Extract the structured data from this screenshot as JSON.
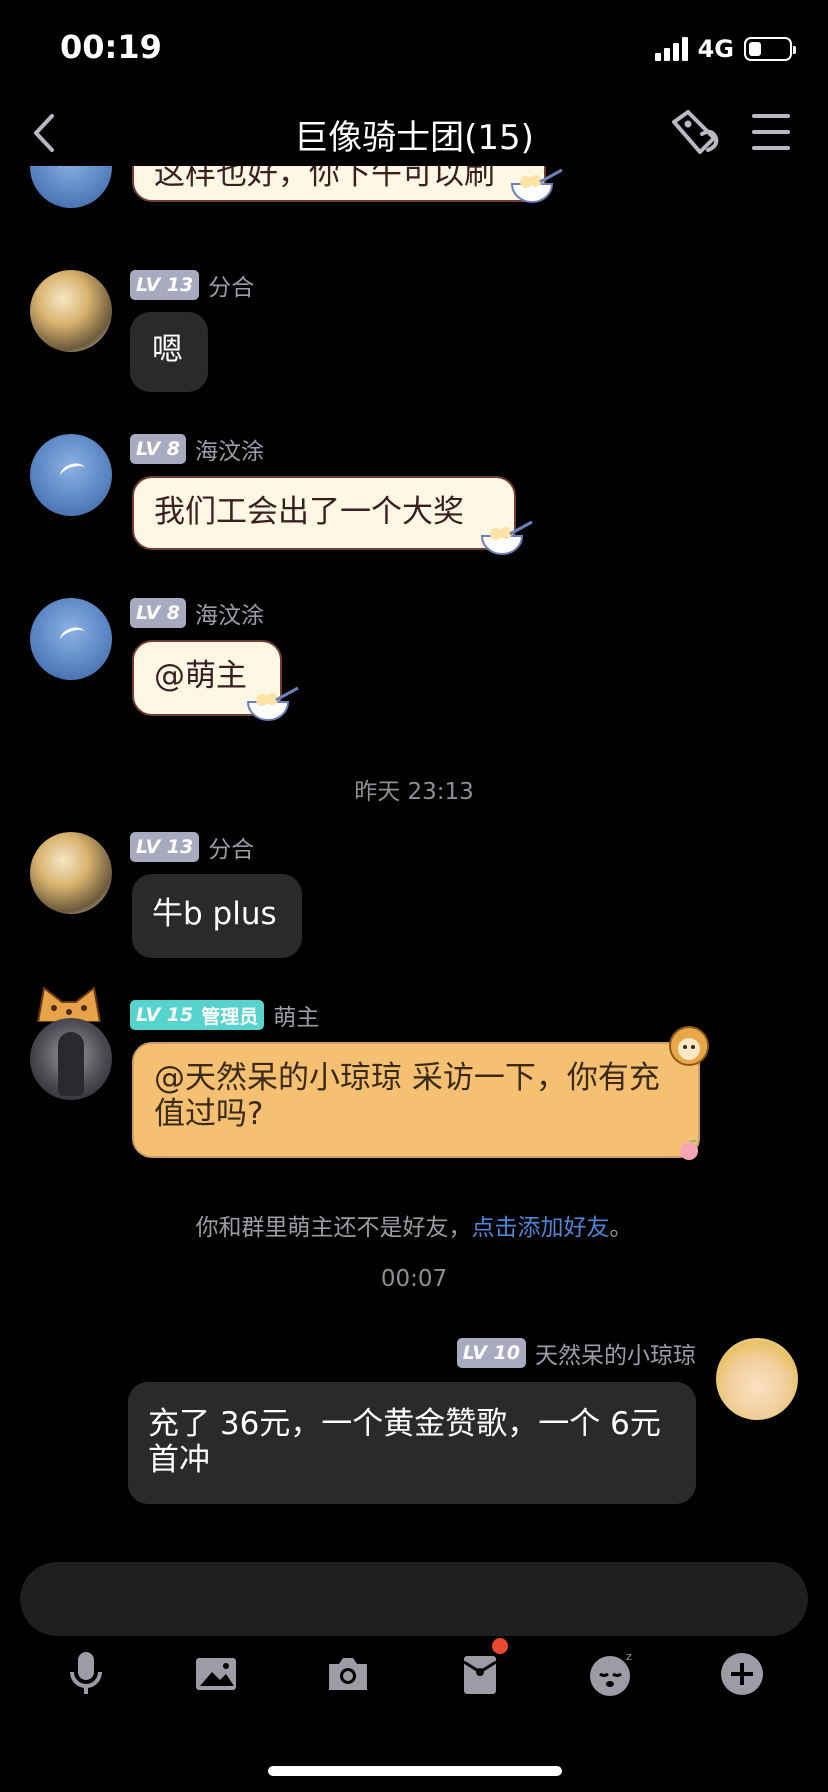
{
  "status_bar": {
    "time": "00:19",
    "network": "4G"
  },
  "header": {
    "title": "巨像骑士团(15)"
  },
  "messages": [
    {
      "sender": "",
      "level": "",
      "text": "这样也好，你下午可以刷"
    },
    {
      "sender": "分合",
      "level": "LV 13",
      "text": "嗯"
    },
    {
      "sender": "海汶涂",
      "level": "LV 8",
      "text": "我们工会出了一个大奖"
    },
    {
      "sender": "海汶涂",
      "level": "LV 8",
      "text": "@萌主"
    },
    {
      "sender": "分合",
      "level": "LV 13",
      "text": "牛b plus"
    },
    {
      "sender": "萌主",
      "level": "LV 15",
      "role": "管理员",
      "text": "@天然呆的小琼琼 采访一下，你有充值过吗?"
    },
    {
      "sender": "天然呆的小琼琼",
      "level": "LV 10",
      "text": "充了 36元，一个黄金赞歌，一个 6元首冲"
    }
  ],
  "timestamps": [
    "昨天 23:13",
    "00:07"
  ],
  "system_notice": {
    "text": "你和群里萌主还不是好友，",
    "link": "点击添加好友",
    "suffix": "。"
  },
  "toolbar": {
    "icons": [
      "microphone-icon",
      "image-icon",
      "camera-icon",
      "red-packet-icon",
      "sleepy-emoji-icon",
      "plus-icon"
    ],
    "badge_color": "#e8492f"
  },
  "colors": {
    "cream_bubble": "#fef7e4",
    "gold_bubble": "#f5c071",
    "dark_bubble": "#2a2a2c",
    "link": "#4f87d8",
    "admin_badge": "#55d3cc"
  }
}
